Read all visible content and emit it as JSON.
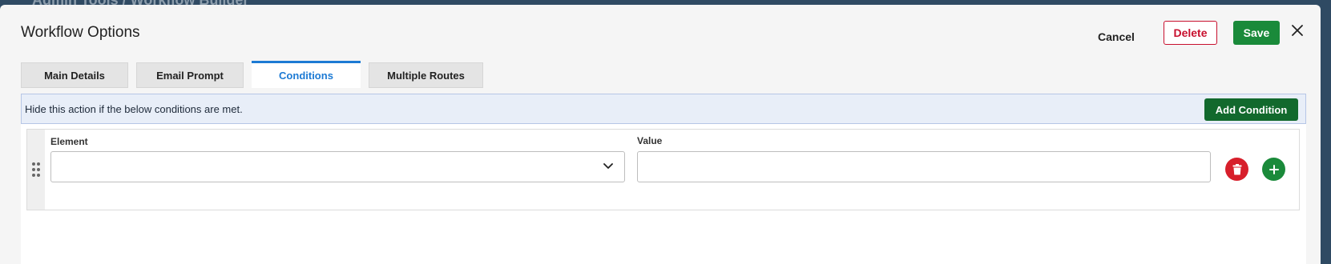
{
  "backdrop": {
    "title": "Admin Tools / Workflow Builder"
  },
  "dialog": {
    "title": "Workflow Options",
    "actions": {
      "cancel_label": "Cancel",
      "delete_label": "Delete",
      "save_label": "Save"
    }
  },
  "tabs": [
    {
      "label": "Main Details",
      "active": false
    },
    {
      "label": "Email Prompt",
      "active": false
    },
    {
      "label": "Conditions",
      "active": true
    },
    {
      "label": "Multiple Routes",
      "active": false
    }
  ],
  "conditions": {
    "info_text": "Hide this action if the below conditions are met.",
    "add_label": "Add Condition",
    "rows": [
      {
        "element_label": "Element",
        "element_value": "",
        "value_label": "Value",
        "value_value": ""
      }
    ]
  },
  "colors": {
    "accent": "#1c7ad4",
    "save": "#1a8a3a",
    "delete": "#c8102e",
    "add_condition": "#12692d",
    "info_bg": "#e8eef8"
  }
}
